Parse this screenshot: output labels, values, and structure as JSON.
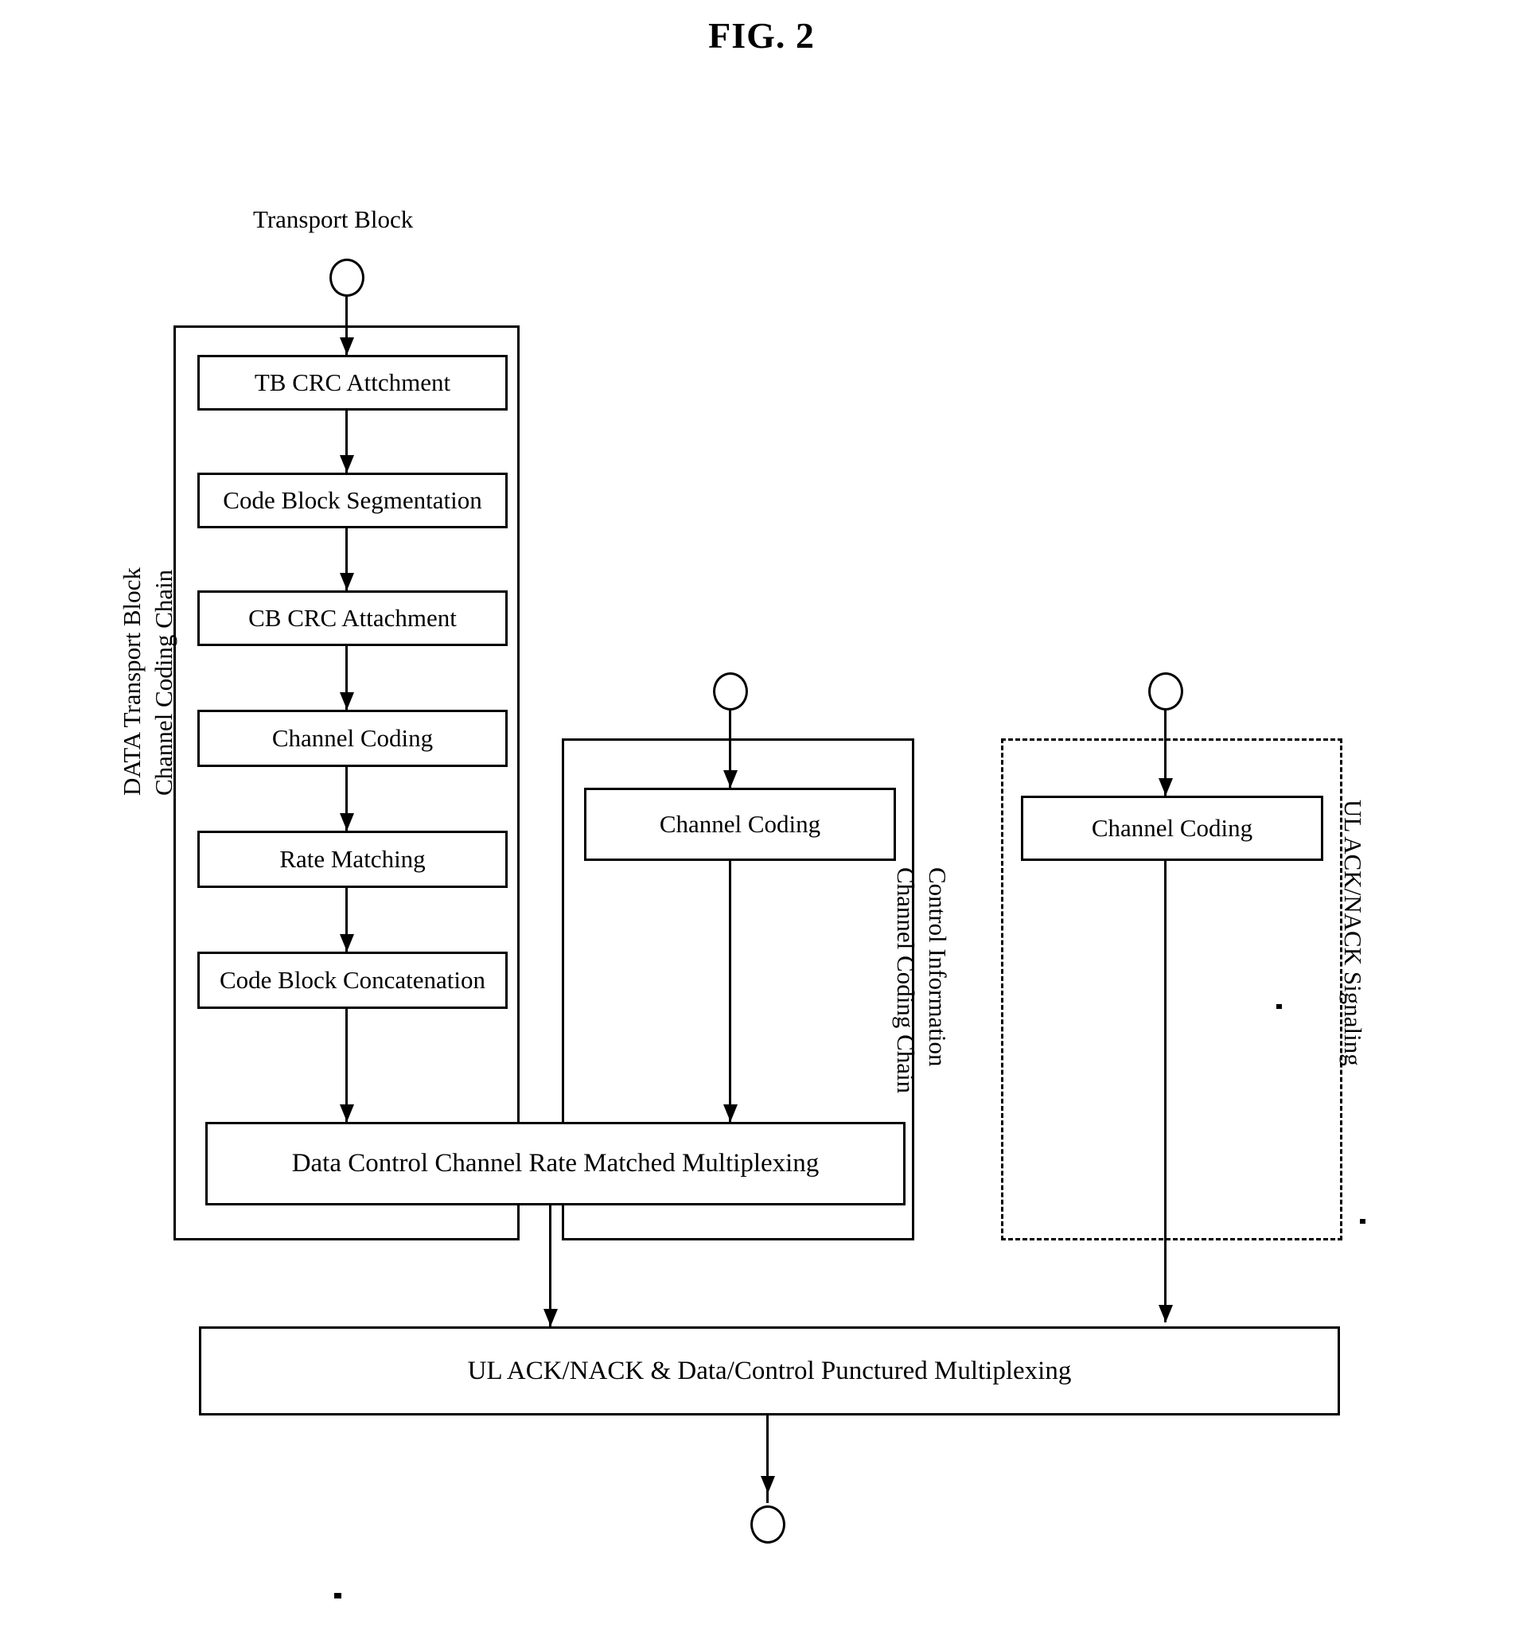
{
  "figure": {
    "title": "FIG. 2",
    "type": "flowchart"
  },
  "entry_labels": {
    "transport_block": "Transport Block"
  },
  "group_labels": {
    "data_chain_line1": "DATA Transport Block",
    "data_chain_line2": "Channel Coding Chain",
    "control_chain_line1": "Control Information",
    "control_chain_line2": "Channel Coding Chain",
    "ack_nack_chain": "UL ACK/NACK Signaling"
  },
  "data_chain_blocks": [
    {
      "id": "tb-crc-attachment",
      "label": "TB CRC Attchment"
    },
    {
      "id": "code-block-segmentation",
      "label": "Code Block Segmentation"
    },
    {
      "id": "cb-crc-attachment",
      "label": "CB CRC Attachment"
    },
    {
      "id": "channel-coding-data",
      "label": "Channel Coding"
    },
    {
      "id": "rate-matching",
      "label": "Rate Matching"
    },
    {
      "id": "code-block-concatenation",
      "label": "Code Block Concatenation"
    }
  ],
  "control_chain_blocks": [
    {
      "id": "channel-coding-control",
      "label": "Channel Coding"
    }
  ],
  "ack_nack_blocks": [
    {
      "id": "channel-coding-acknack",
      "label": "Channel Coding"
    }
  ],
  "merge_blocks": {
    "rate_matched_mux": "Data Control Channel Rate Matched Multiplexing",
    "punctured_mux": "UL ACK/NACK & Data/Control Punctured Multiplexing"
  },
  "colors": {
    "stroke": "#000000",
    "background": "#ffffff"
  }
}
